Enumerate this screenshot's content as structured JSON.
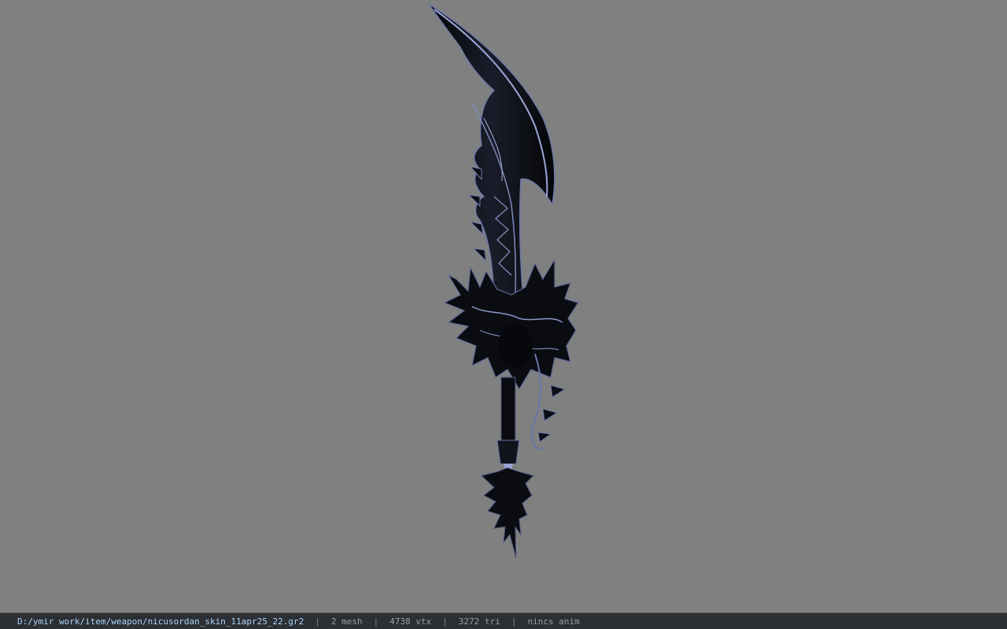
{
  "viewport": {
    "background": "#808080",
    "model_icon": "curved-sword-model"
  },
  "statusbar": {
    "file_path": "D:/ymir work/item/weapon/nicusordan_skin_11apr25_22.gr2",
    "separator": "|",
    "mesh_count": "2 mesh",
    "vertex_count": "4738 vtx",
    "triangle_count": "3272 tri",
    "animation": "nincs anim"
  },
  "colors": {
    "statusbar_bg": "#2c2f33",
    "path_text": "#a9d6ff",
    "stat_text": "#9aa0a6",
    "blade_dark": "#0e1018",
    "blade_highlight": "#8a96c4"
  }
}
